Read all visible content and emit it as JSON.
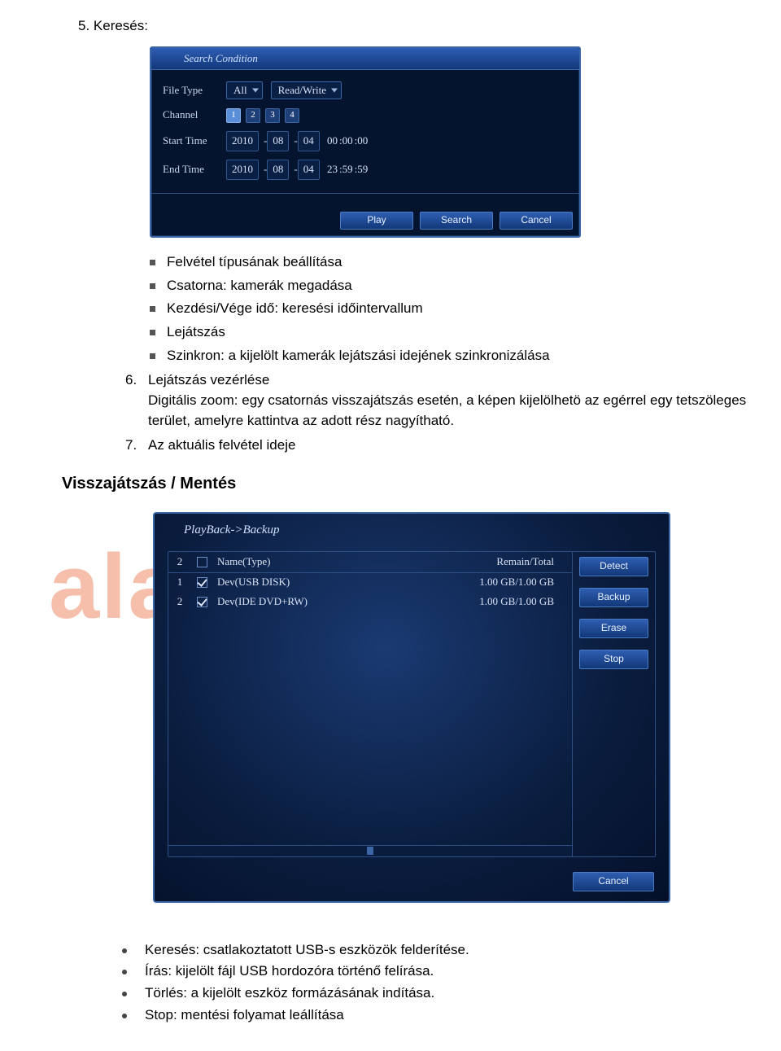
{
  "top_title": "5. Keresés:",
  "search_panel": {
    "title": "Search Condition",
    "labels": {
      "file_type": "File Type",
      "channel": "Channel",
      "start_time": "Start Time",
      "end_time": "End Time"
    },
    "file_type_value": "All",
    "mode_value": "Read/Write",
    "channels": [
      "1",
      "2",
      "3",
      "4"
    ],
    "start_date": {
      "y": "2010",
      "m": "08",
      "d": "04"
    },
    "start_time": {
      "h": "00",
      "mi": "00",
      "s": "00"
    },
    "end_date": {
      "y": "2010",
      "m": "08",
      "d": "04"
    },
    "end_time": {
      "h": "23",
      "mi": "59",
      "s": "59"
    },
    "buttons": {
      "play": "Play",
      "search": "Search",
      "cancel": "Cancel"
    }
  },
  "bullets": [
    "Felvétel típusának beállítása",
    "Csatorna: kamerák megadása",
    "Kezdési/Vége idő: keresési időintervallum",
    "Lejátszás",
    "Szinkron: a kijelölt kamerák lejátszási idejének szinkronizálása"
  ],
  "num6": {
    "title": "Lejátszás vezérlése",
    "desc": "Digitális zoom: egy csatornás visszajátszás esetén, a képen kijelölhetö az egérrel egy tetszöleges terület, amelyre kattintva az adott rész nagyítható."
  },
  "num7": "Az aktuális felvétel ideje",
  "section2": "Visszajátszás / Mentés",
  "backup_panel": {
    "title": "PlayBack->Backup",
    "header": {
      "count": "2",
      "name": "Name(Type)",
      "remain": "Remain/Total"
    },
    "rows": [
      {
        "idx": "1",
        "checked": true,
        "name": "Dev(USB DISK)",
        "remain": "1.00 GB/1.00 GB"
      },
      {
        "idx": "2",
        "checked": true,
        "name": "Dev(IDE DVD+RW)",
        "remain": "1.00 GB/1.00 GB"
      }
    ],
    "side_buttons": {
      "detect": "Detect",
      "backup": "Backup",
      "erase": "Erase",
      "stop": "Stop"
    },
    "cancel": "Cancel"
  },
  "watermark": "alarm shop",
  "footer_bullets": [
    "Keresés: csatlakoztatott USB-s eszközök felderítése.",
    "Írás:   kijelölt fájl USB hordozóra történő felírása.",
    "Törlés: a kijelölt eszköz formázásának indítása.",
    "Stop: mentési folyamat leállítása"
  ]
}
